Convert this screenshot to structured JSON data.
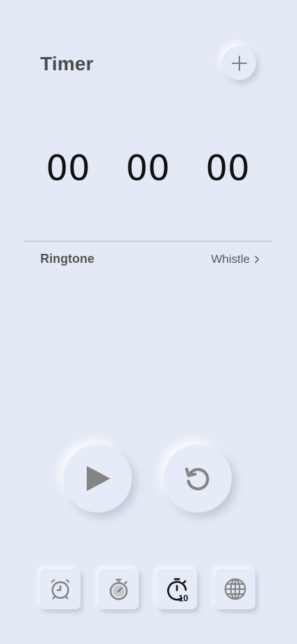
{
  "header": {
    "title": "Timer",
    "add_icon": "plus-icon"
  },
  "time": {
    "hours": "00",
    "minutes": "00",
    "seconds": "00"
  },
  "ringtone": {
    "label": "Ringtone",
    "value": "Whistle",
    "chevron_icon": "chevron-right-icon"
  },
  "controls": {
    "start_icon": "play-icon",
    "reset_icon": "reset-icon"
  },
  "bottom_nav": {
    "items": [
      {
        "icon": "alarm-clock-icon"
      },
      {
        "icon": "stopwatch-icon"
      },
      {
        "icon": "timer-10-icon",
        "active": true
      },
      {
        "icon": "globe-icon"
      }
    ]
  },
  "colors": {
    "background": "#e4eaf5",
    "icon_gray": "#848484",
    "digits": "#101010"
  }
}
